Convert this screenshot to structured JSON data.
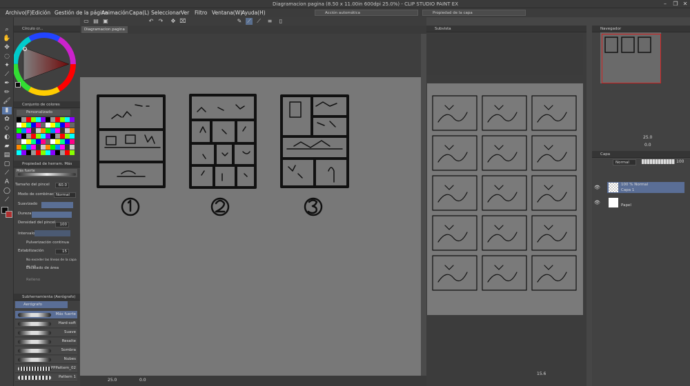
{
  "window": {
    "title": "Diagramacion pagina (8.50 x 11.00in 600dpi 25.0%) - CLIP STUDIO PAINT EX"
  },
  "menu": [
    "Archivo(F)",
    "Edición",
    "Gestión de la página",
    "Animación",
    "Capa(L)",
    "Seleccionar",
    "Ver",
    "Filtro",
    "Ventana(W)",
    "Ayuda(H)"
  ],
  "floating_tabs": {
    "auto_action": "Acción automática",
    "tool_property": "Propiedad de la capa"
  },
  "color_panel": {
    "title": "Círculo cr..."
  },
  "color_set": {
    "title": "Conjunto de colores",
    "preset": "Personalizado"
  },
  "tool_property": {
    "title": "Propiedad de herram. Más fuer...",
    "brush_name": "Más fuerte",
    "brush_size_label": "Tamaño del pincel",
    "brush_size": "60.0",
    "blend_label": "Modo de combinación",
    "blend": "Normal",
    "smoothing_label": "Suavizado",
    "hardness_label": "Dureza",
    "density_label": "Densidad del pincel",
    "density": "100",
    "interval_label": "Intervalo",
    "continuous_label": "Pulverización continua",
    "stabilization_label": "Estabilización",
    "stabilization": "15",
    "no_exceed_label": "No exceder las líneas de la capa de ref",
    "area_scale_label": "Escalado de área",
    "fill_label": "Relleno"
  },
  "subtool": {
    "title": "Subherramienta (Aerógrafo)",
    "group": "Aerógrafo",
    "items": [
      "Más fuerte",
      "Hard-soft",
      "Suave",
      "Resalte",
      "Sombra",
      "Nubes",
      "PPPattern_02",
      "Pattern 1"
    ]
  },
  "canvas": {
    "tab": "Diagramacion pagina",
    "zoom": "25.0",
    "rotation": "0.0"
  },
  "subview": {
    "title": "Subvista",
    "zoom": "15.6"
  },
  "navigator": {
    "title": "Navegador",
    "zoom": "25.0",
    "rotation": "0.0"
  },
  "layers": {
    "title": "Capa",
    "blend": "Normal",
    "opacity": "100",
    "items": [
      {
        "line1": "100 % Normal",
        "line2": "Capa 1",
        "selected": true
      },
      {
        "line1": "",
        "line2": "Papel",
        "selected": false
      }
    ]
  },
  "colors": {
    "accent": "#5b78a8",
    "panel": "#404040",
    "paper": "#787878",
    "subview": "#7a7a7a"
  }
}
